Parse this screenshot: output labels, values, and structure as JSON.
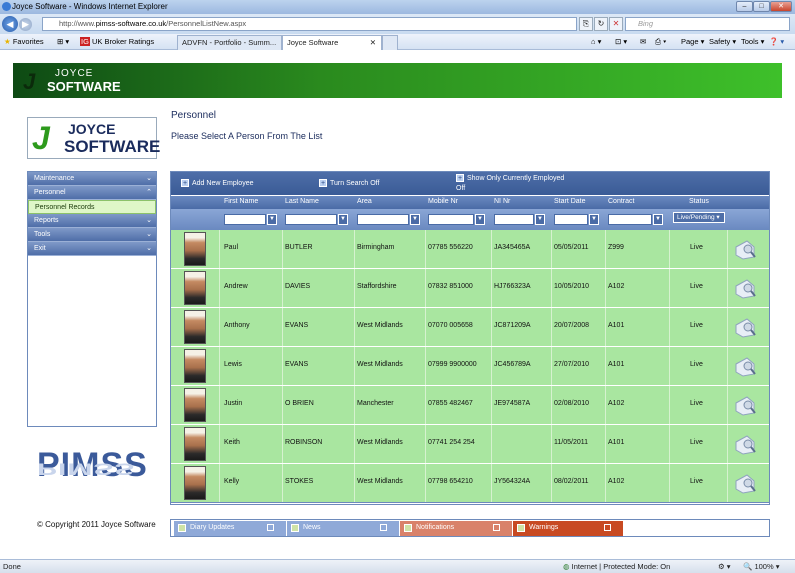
{
  "browser": {
    "window_title": "Joyce Software - Windows Internet Explorer",
    "url_prefix": "http://www.",
    "url_domain": "pimss-software.co.uk",
    "url_path": "/PersonnelListNew.aspx",
    "search_placeholder": "Bing",
    "favorites_label": "Favorites",
    "fav_links": [
      "UK Broker Ratings",
      "ADVFN - Portfolio - Summ...",
      "Joyce Software"
    ],
    "menu_page": "Page",
    "menu_safety": "Safety",
    "menu_tools": "Tools",
    "status_done": "Done",
    "status_zone": "Internet | Protected Mode: On",
    "status_zoom": "100%"
  },
  "brand": {
    "joyce": "JOYCE",
    "software": "SOFTWARE",
    "pimss": "PIMSS"
  },
  "sidebar": {
    "items": [
      {
        "label": "Maintenance",
        "chevron": "⌄"
      },
      {
        "label": "Personnel",
        "chevron": "⌃"
      },
      {
        "label": "Personnel Records",
        "chevron": ""
      },
      {
        "label": "Reports",
        "chevron": "⌄"
      },
      {
        "label": "Tools",
        "chevron": "⌄"
      },
      {
        "label": "Exit",
        "chevron": "⌄"
      }
    ]
  },
  "page": {
    "title": "Personnel",
    "subtitle": "Please Select A Person From The List",
    "copyright": "© Copyright 2011 Joyce Software"
  },
  "toolbar": {
    "add_label": "Add New Employee",
    "search_label": "Turn Search Off",
    "show_label": "Show  Only  Currently  Employed",
    "off_label": "Off"
  },
  "columns": [
    "First Name",
    "Last Name",
    "Area",
    "Mobile Nr",
    "NI Nr",
    "Start Date",
    "Contract",
    "Status"
  ],
  "status_filter": "Live/Pending",
  "rows": [
    {
      "first": "Paul",
      "last": "BUTLER",
      "area": "Birmingham",
      "mobile": "07785 556220",
      "ni": "JA345465A",
      "start": "05/05/2011",
      "contract": "Z999",
      "status": "Live"
    },
    {
      "first": "Andrew",
      "last": "DAVIES",
      "area": "Staffordshire",
      "mobile": "07832 851000",
      "ni": "HJ766323A",
      "start": "10/05/2010",
      "contract": "A102",
      "status": "Live"
    },
    {
      "first": "Anthony",
      "last": "EVANS",
      "area": "West Midlands",
      "mobile": "07070 005658",
      "ni": "JC871209A",
      "start": "20/07/2008",
      "contract": "A101",
      "status": "Live"
    },
    {
      "first": "Lewis",
      "last": "EVANS",
      "area": "West Midlands",
      "mobile": "07999 9900000",
      "ni": "JC456789A",
      "start": "27/07/2010",
      "contract": "A101",
      "status": "Live"
    },
    {
      "first": "Justin",
      "last": "O BRIEN",
      "area": "Manchester",
      "mobile": "07855 482467",
      "ni": "JE974587A",
      "start": "02/08/2010",
      "contract": "A102",
      "status": "Live"
    },
    {
      "first": "Keith",
      "last": "ROBINSON",
      "area": "West Midlands",
      "mobile": "07741 254 254",
      "ni": "",
      "start": "11/05/2011",
      "contract": "A101",
      "status": "Live"
    },
    {
      "first": "Kelly",
      "last": "STOKES",
      "area": "West Midlands",
      "mobile": "07798 654210",
      "ni": "JY564324A",
      "start": "08/02/2011",
      "contract": "A102",
      "status": "Live"
    }
  ],
  "docks": [
    {
      "label": "Diary Updates",
      "color": "#8fa9d8"
    },
    {
      "label": "News",
      "color": "#8fa9d8"
    },
    {
      "label": "Notifications",
      "color": "#d9826a"
    },
    {
      "label": "Warnings",
      "color": "#c84a22"
    }
  ],
  "colors": {
    "row_bg": "#a9e6a0",
    "grid_header": "#4e6ea8",
    "banner": "#2a8a1e"
  }
}
